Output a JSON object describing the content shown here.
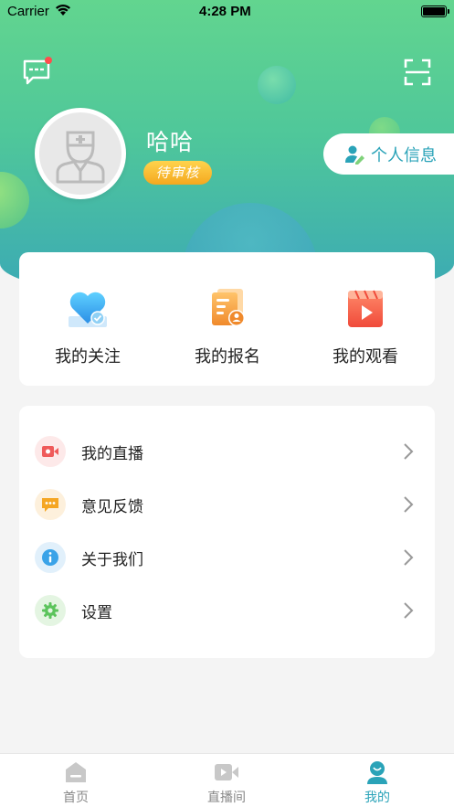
{
  "status_bar": {
    "carrier": "Carrier",
    "time": "4:28 PM"
  },
  "profile": {
    "name": "哈哈",
    "status_badge": "待审核",
    "info_button": "个人信息"
  },
  "shortcuts": [
    {
      "label": "我的关注",
      "icon": "heart-icon"
    },
    {
      "label": "我的报名",
      "icon": "registration-icon"
    },
    {
      "label": "我的观看",
      "icon": "video-clapper-icon"
    }
  ],
  "menu": [
    {
      "label": "我的直播",
      "icon": "camera-icon",
      "color": "#ef5a5a"
    },
    {
      "label": "意见反馈",
      "icon": "feedback-icon",
      "color": "#f5a623"
    },
    {
      "label": "关于我们",
      "icon": "info-icon",
      "color": "#3aa3e8"
    },
    {
      "label": "设置",
      "icon": "gear-icon",
      "color": "#5cc45c"
    }
  ],
  "tabbar": [
    {
      "label": "首页",
      "icon": "home-icon"
    },
    {
      "label": "直播间",
      "icon": "live-room-icon"
    },
    {
      "label": "我的",
      "icon": "user-icon",
      "active": true
    }
  ],
  "colors": {
    "accent": "#2aa3b8",
    "header_top": "#62d58f",
    "badge": "#f4a81f"
  }
}
